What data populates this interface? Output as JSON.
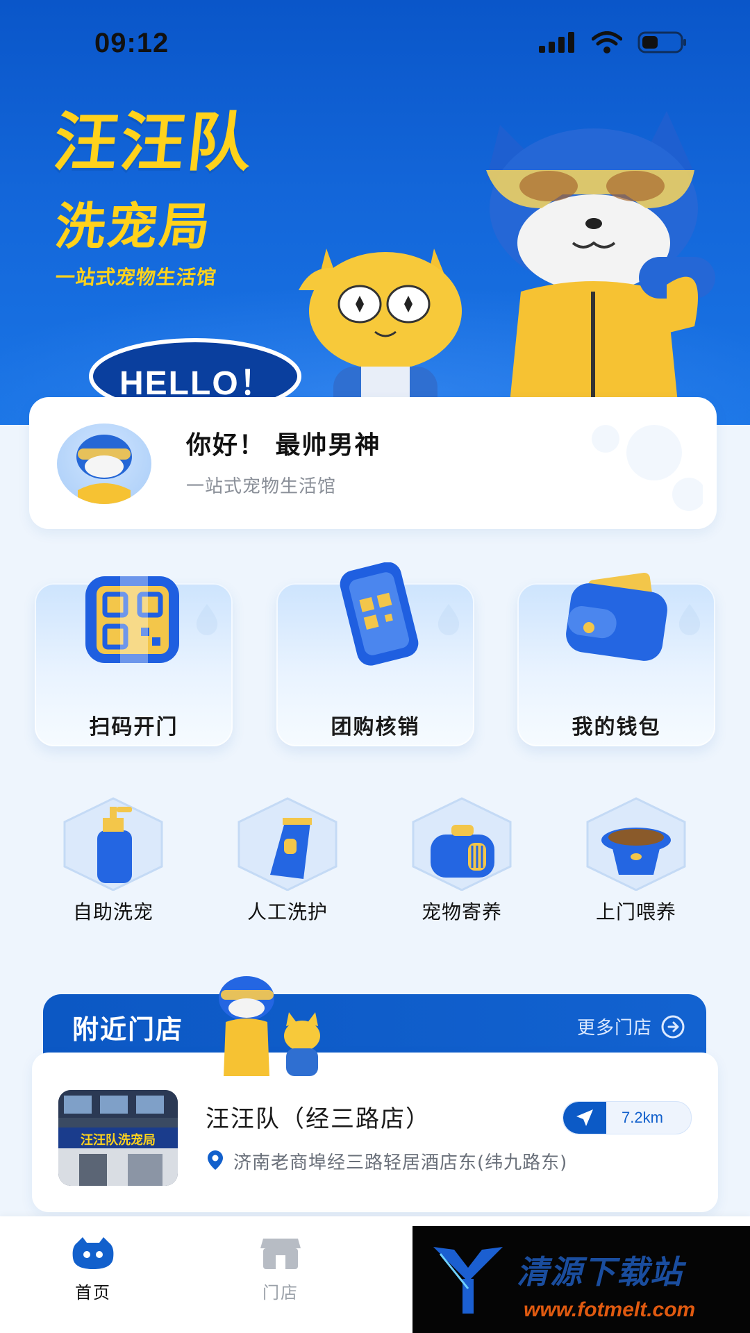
{
  "status_bar": {
    "time": "09:12"
  },
  "banner": {
    "title": "汪汪队",
    "subtitle": "洗宠局",
    "tagline": "一站式宠物生活馆",
    "bubble": "HELLO！"
  },
  "greeting": {
    "title": "你好！ 最帅男神",
    "subtitle": "一站式宠物生活馆"
  },
  "quick_actions": [
    {
      "label": "扫码开门",
      "icon": "qr-scan-icon"
    },
    {
      "label": "团购核销",
      "icon": "phone-qr-icon"
    },
    {
      "label": "我的钱包",
      "icon": "wallet-icon"
    }
  ],
  "services": [
    {
      "label": "自助洗宠",
      "icon": "shampoo-bottle-icon"
    },
    {
      "label": "人工洗护",
      "icon": "clipper-icon"
    },
    {
      "label": "宠物寄养",
      "icon": "pet-carrier-icon"
    },
    {
      "label": "上门喂养",
      "icon": "food-bowl-icon"
    }
  ],
  "nearby": {
    "title": "附近门店",
    "more_label": "更多门店",
    "store": {
      "name": "汪汪队（经三路店）",
      "address": "济南老商埠经三路轻居酒店东(纬九路东)",
      "distance": "7.2km",
      "photo_sign": "汪汪队洗宠局"
    }
  },
  "bottom_nav": {
    "home": "首页",
    "stores": "门店"
  },
  "watermark": {
    "text": "清源下载站",
    "url": "www.fotmelt.com"
  },
  "colors": {
    "primary": "#0c58c4",
    "accent_yellow": "#ffd21c",
    "background": "#eef5fd"
  }
}
